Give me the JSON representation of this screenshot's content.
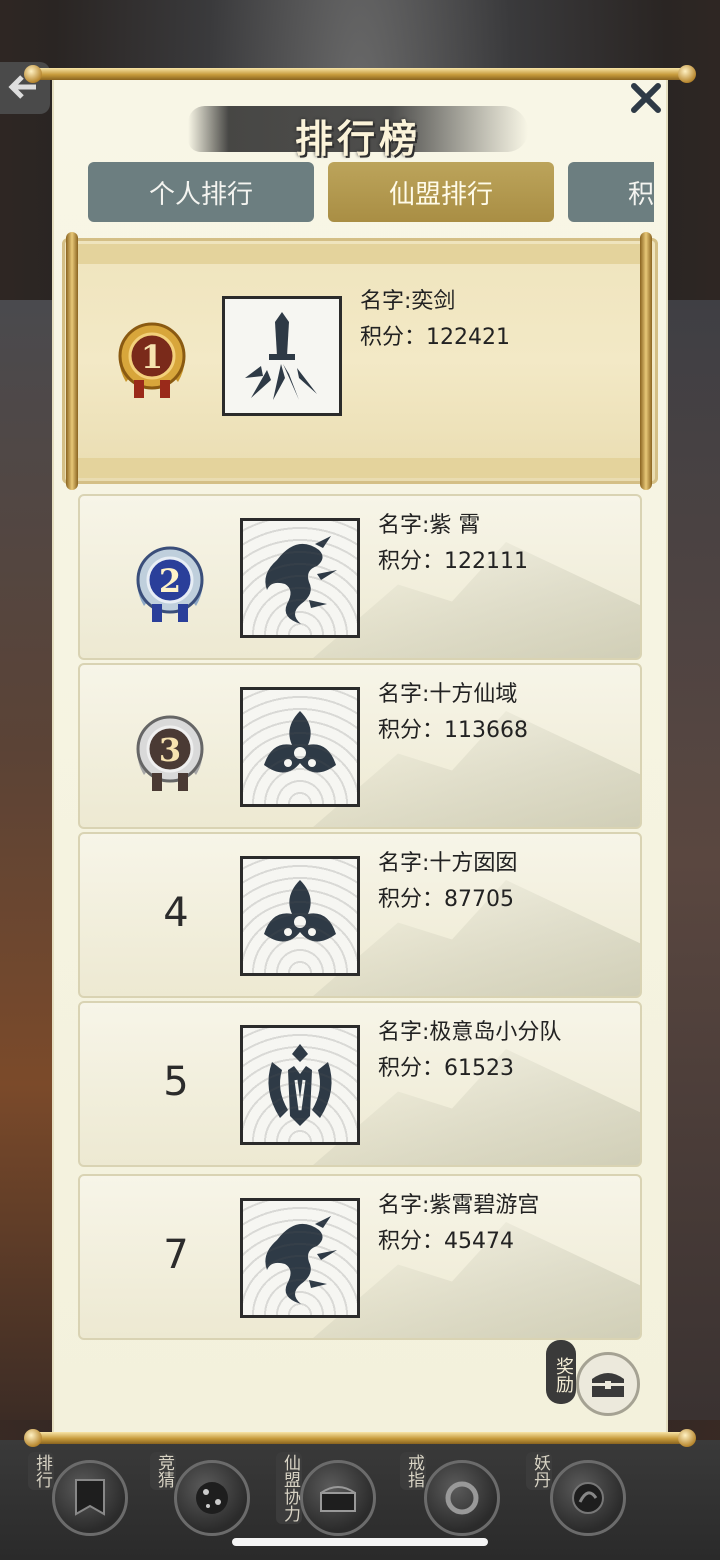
{
  "dialog": {
    "title": "排行榜",
    "tabs": [
      {
        "label": "个人排行",
        "active": false
      },
      {
        "label": "仙盟排行",
        "active": true
      },
      {
        "label": "积",
        "active": false
      }
    ]
  },
  "rankings": [
    {
      "rank": "1",
      "medal": "gold",
      "name": "名字:奕剑",
      "score": "积分：122421",
      "emblem": "sword-emblem"
    },
    {
      "rank": "2",
      "medal": "blue",
      "name": "名字:紫  霄",
      "score": "积分：122111",
      "emblem": "dragon-emblem"
    },
    {
      "rank": "3",
      "medal": "silver",
      "name": "名字:十方仙域",
      "score": "积分：113668",
      "emblem": "trefoil-emblem"
    },
    {
      "rank": "4",
      "medal": null,
      "name": "名字:十方囡囡",
      "score": "积分：87705",
      "emblem": "trefoil-emblem"
    },
    {
      "rank": "5",
      "medal": null,
      "name": "名字:极意岛小分队",
      "score": "积分：61523",
      "emblem": "crown-emblem"
    },
    {
      "rank": "7",
      "medal": null,
      "name": "名字:紫霄碧游宫",
      "score": "积分：45474",
      "emblem": "dragon-emblem"
    }
  ],
  "reward": {
    "label": "奖励"
  },
  "bottom_nav": [
    {
      "label": "排行",
      "icon": "banner-icon"
    },
    {
      "label": "竞猜",
      "icon": "dice-icon"
    },
    {
      "label": "仙盟协力",
      "icon": "chest-icon"
    },
    {
      "label": "戒指",
      "icon": "ring-icon"
    },
    {
      "label": "妖丹",
      "icon": "orb-icon"
    }
  ],
  "colors": {
    "active_tab": "#a98e44",
    "inactive_tab": "#6c7e80",
    "panel": "#f3f1dc"
  }
}
